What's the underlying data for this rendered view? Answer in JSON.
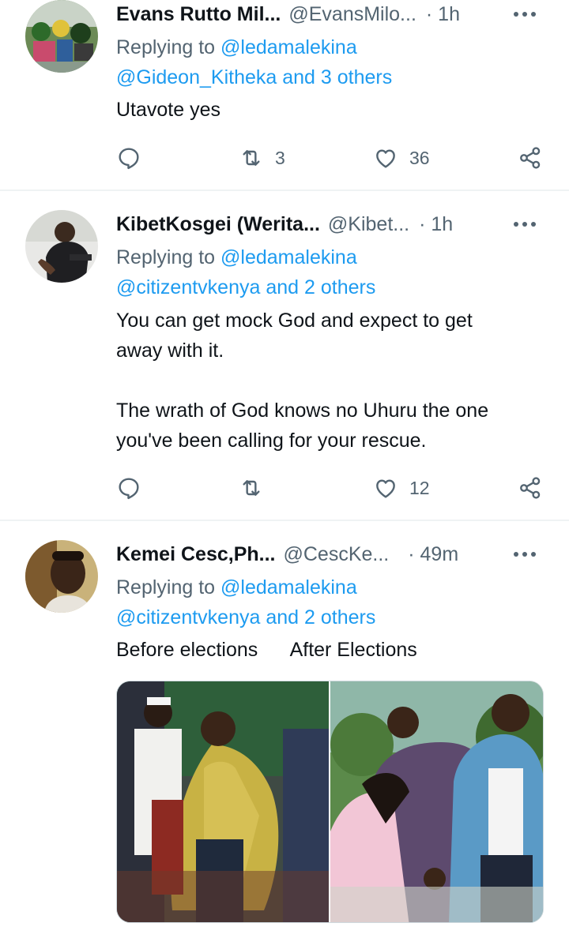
{
  "tweets": [
    {
      "name": "Evans Rutto Mil...",
      "handle": "@EvansMilo...",
      "time": "· 1h",
      "replying_prefix": "Replying to ",
      "replying_mention": "@ledamalekina",
      "replying_line2": "@Gideon_Kitheka and 3 others",
      "text": "Utavote yes",
      "retweets": "3",
      "likes": "36"
    },
    {
      "name": "KibetKosgei (Werita...",
      "handle": "@Kibet...",
      "time": "· 1h",
      "replying_prefix": "Replying to ",
      "replying_mention": "@ledamalekina",
      "replying_line2": "@citizentvkenya and 2 others",
      "text": "You can get mock God and expect to get\naway with it.\n\nThe wrath of God knows no Uhuru the one\nyou've been calling for your rescue.",
      "retweets": "",
      "likes": "12"
    },
    {
      "name": "Kemei Cesc,Ph...",
      "handle": "@CescKe...",
      "time": "· 49m",
      "replying_prefix": "Replying to ",
      "replying_mention": "@ledamalekina",
      "replying_line2": "@citizentvkenya and 2 others",
      "text": "Before elections      After Elections",
      "retweets": "",
      "likes": ""
    }
  ],
  "icons": {
    "reply": "reply-icon",
    "retweet": "retweet-icon",
    "like": "heart-icon",
    "share": "share-icon",
    "more": "more-icon"
  },
  "colors": {
    "link": "#1d9bf0",
    "secondary_text": "#536471",
    "divider": "#eff3f4"
  }
}
